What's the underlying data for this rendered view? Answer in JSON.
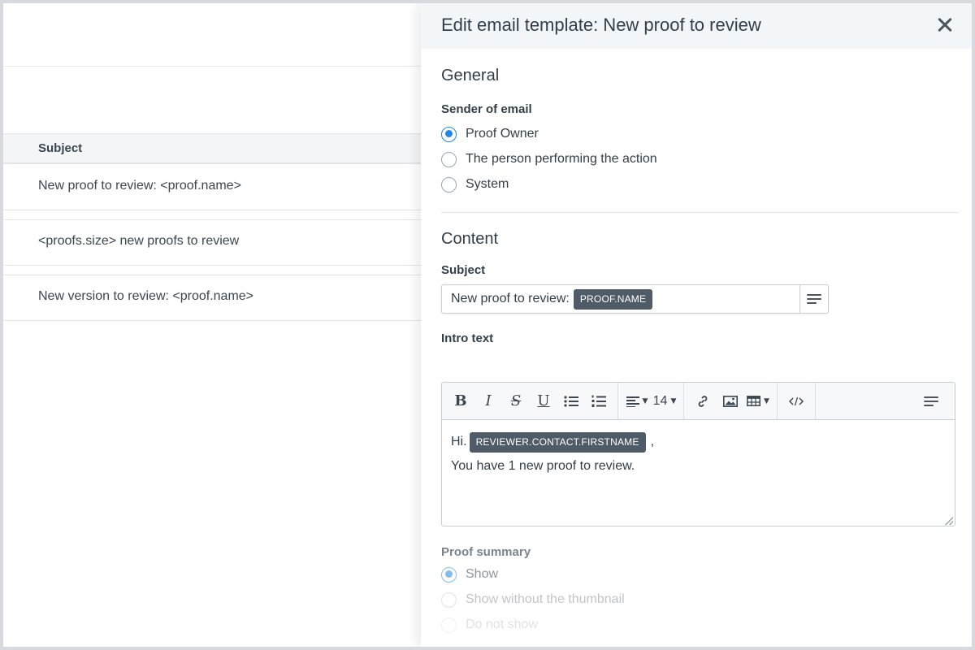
{
  "background_list": {
    "column_header": "Subject",
    "rows": [
      "New proof to review: <proof.name>",
      "<proofs.size> new proofs to review",
      "New version to review: <proof.name>"
    ]
  },
  "panel": {
    "title": "Edit email template: New proof to review",
    "general": {
      "title": "General",
      "sender_label": "Sender of email",
      "sender_options": [
        "Proof Owner",
        "The person performing the action",
        "System"
      ],
      "sender_selected": "Proof Owner"
    },
    "content": {
      "title": "Content",
      "subject_label": "Subject",
      "subject_text": "New proof to review:",
      "subject_token": "PROOF.NAME",
      "intro_label": "Intro text",
      "toolbar": {
        "bold": "B",
        "italic": "I",
        "strike": "S",
        "underline": "U",
        "font_size": "14"
      },
      "intro_greeting": "Hi.",
      "intro_token": "REVIEWER.CONTACT.FIRSTNAME",
      "intro_comma": ",",
      "intro_body": "You have 1 new proof to review."
    },
    "proof_summary": {
      "label": "Proof summary",
      "options": [
        "Show",
        "Show without the thumbnail",
        "Do not show"
      ],
      "selected": "Show"
    }
  },
  "colors": {
    "accent": "#1e88e5",
    "token_bg": "#4f5b66",
    "panel_header_bg": "#f3f6f9"
  }
}
